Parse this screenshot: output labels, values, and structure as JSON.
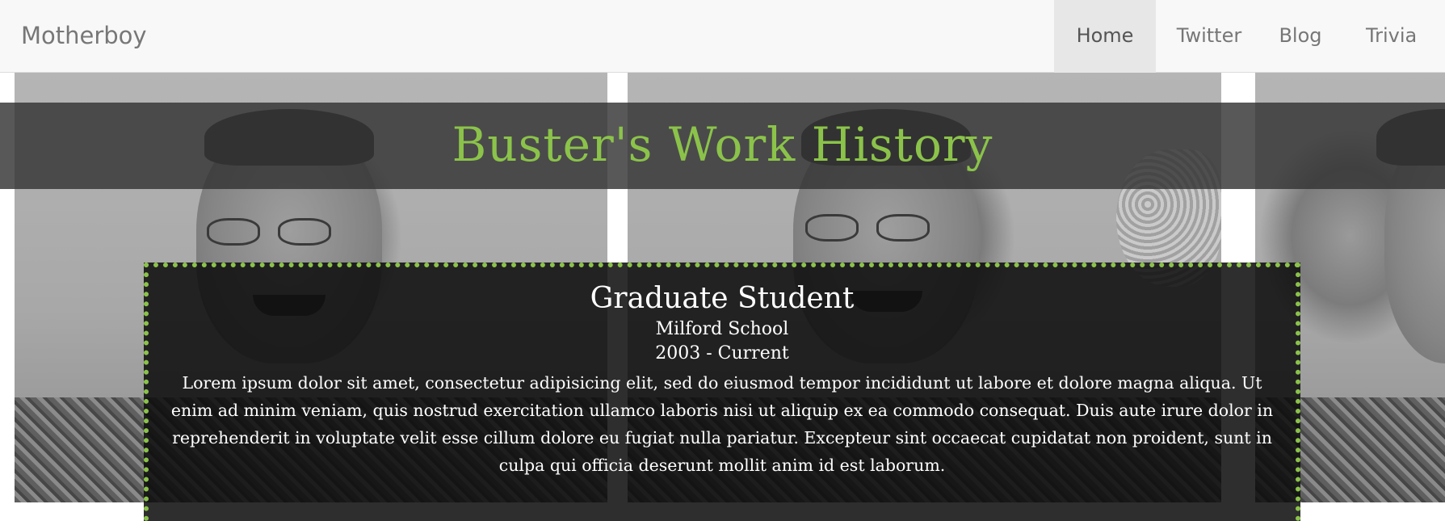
{
  "navbar": {
    "brand": "Motherboy",
    "items": [
      {
        "label": "Home",
        "active": true
      },
      {
        "label": "Twitter",
        "active": false
      },
      {
        "label": "Blog",
        "active": false
      },
      {
        "label": "Trivia",
        "active": false
      }
    ]
  },
  "hero": {
    "title": "Buster's Work History"
  },
  "job": {
    "title": "Graduate Student",
    "organization": "Milford School",
    "dates": "2003 - Current",
    "description": "Lorem ipsum dolor sit amet, consectetur adipisicing elit, sed do eiusmod tempor incididunt ut labore et dolore magna aliqua. Ut enim ad minim veniam, quis nostrud exercitation ullamco laboris nisi ut aliquip ex ea commodo consequat. Duis aute irure dolor in reprehenderit in voluptate velit esse cillum dolore eu fugiat nulla pariatur. Excepteur sint occaecat cupidatat non proident, sunt in culpa qui officia deserunt mollit anim id est laborum."
  },
  "colors": {
    "accent": "#8bc34a",
    "navbar_bg": "#f8f8f8",
    "nav_active_bg": "#e7e7e7",
    "nav_text": "#777777",
    "card_bg": "#0c0c0c"
  }
}
